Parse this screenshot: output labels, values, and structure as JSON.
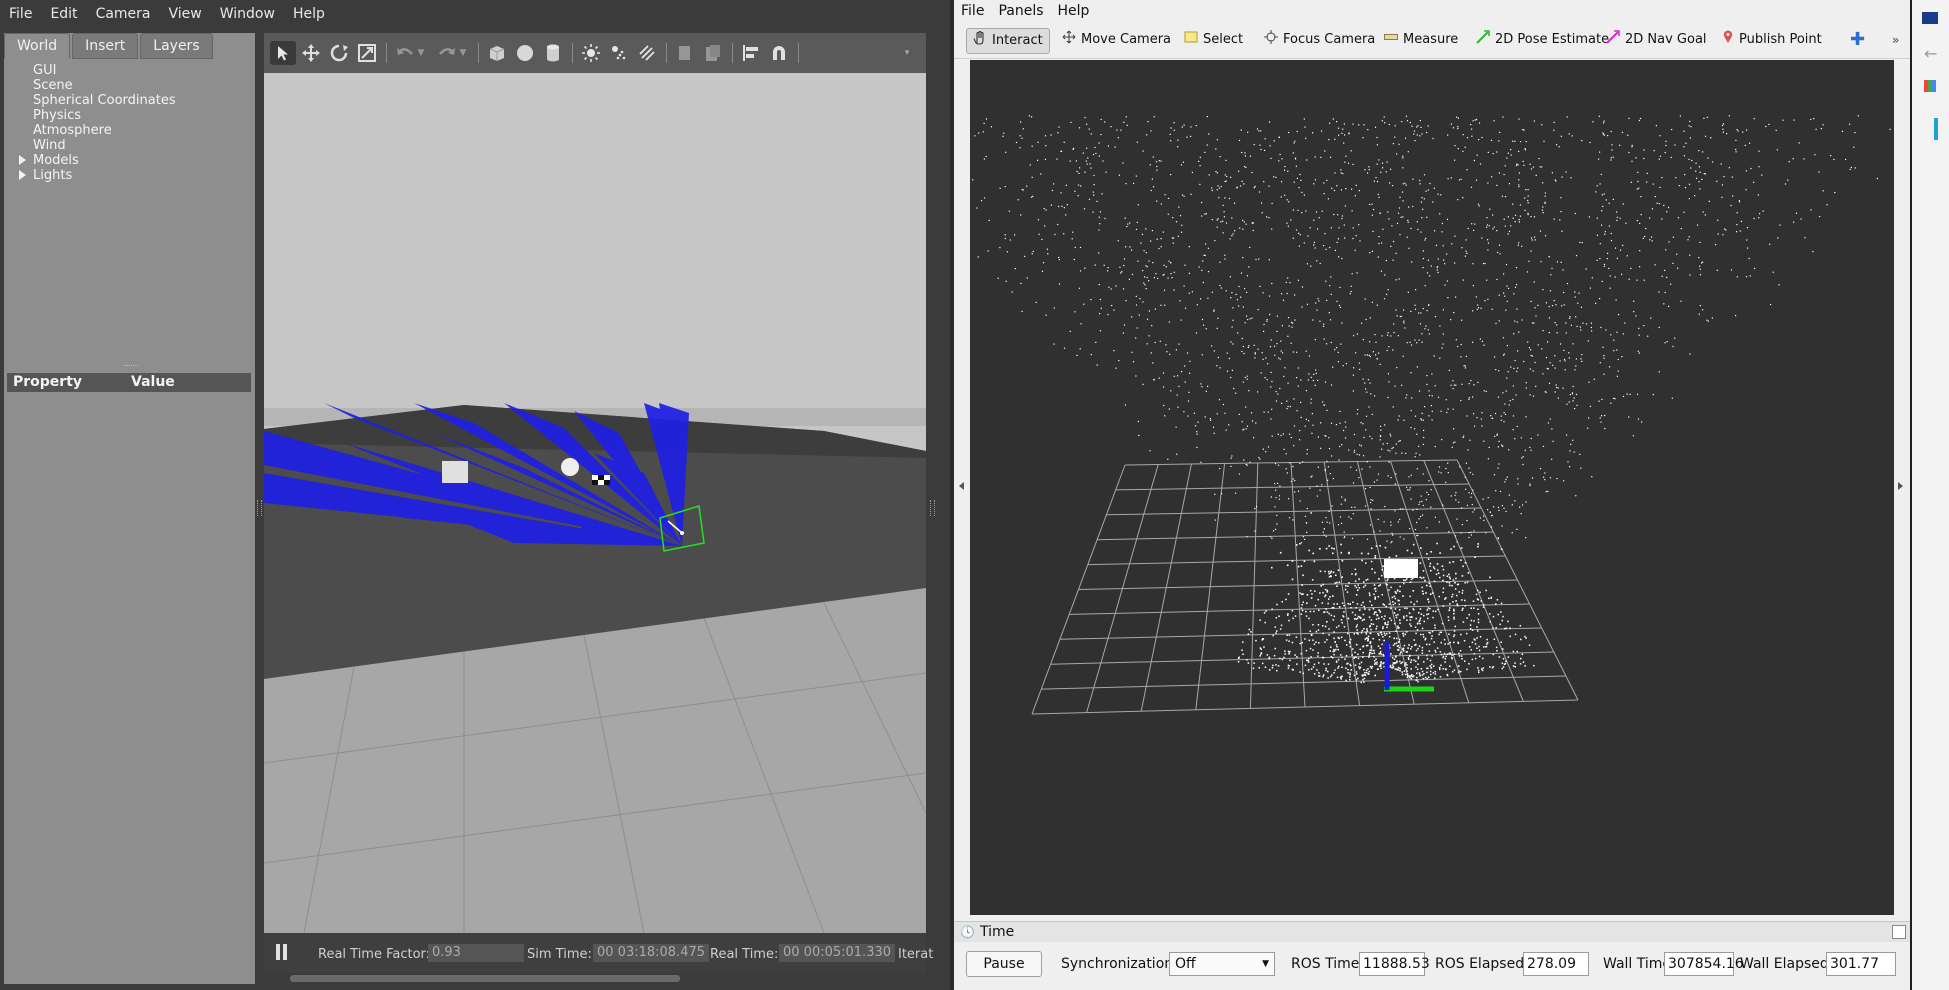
{
  "gazebo": {
    "menu": [
      "File",
      "Edit",
      "Camera",
      "View",
      "Window",
      "Help"
    ],
    "tabs": [
      "World",
      "Insert",
      "Layers"
    ],
    "tree": [
      {
        "label": "GUI",
        "expandable": false
      },
      {
        "label": "Scene",
        "expandable": false
      },
      {
        "label": "Spherical Coordinates",
        "expandable": false
      },
      {
        "label": "Physics",
        "expandable": false
      },
      {
        "label": "Atmosphere",
        "expandable": false
      },
      {
        "label": "Wind",
        "expandable": false
      },
      {
        "label": "Models",
        "expandable": true
      },
      {
        "label": "Lights",
        "expandable": true
      }
    ],
    "property_header": {
      "property": "Property",
      "value": "Value"
    },
    "status": {
      "real_time_factor_label": "Real Time Factor:",
      "real_time_factor": "0.93",
      "sim_time_label": "Sim Time:",
      "sim_time": "00 03:18:08.475",
      "real_time_label": "Real Time:",
      "real_time": "00 00:05:01.330",
      "iterations_label": "Iterat"
    }
  },
  "rviz": {
    "menu": [
      "File",
      "Panels",
      "Help"
    ],
    "tools": [
      {
        "label": "Interact",
        "icon": "hand-icon",
        "active": true
      },
      {
        "label": "Move Camera",
        "icon": "move-camera-icon",
        "active": false
      },
      {
        "label": "Select",
        "icon": "select-box-icon",
        "active": false
      },
      {
        "label": "Focus Camera",
        "icon": "focus-camera-icon",
        "active": false
      },
      {
        "label": "Measure",
        "icon": "ruler-icon",
        "active": false
      },
      {
        "label": "2D Pose Estimate",
        "icon": "green-arrow-icon",
        "active": false
      },
      {
        "label": "2D Nav Goal",
        "icon": "magenta-arrow-icon",
        "active": false
      },
      {
        "label": "Publish Point",
        "icon": "map-pin-icon",
        "active": false
      }
    ],
    "time_panel": {
      "title": "Time",
      "pause_label": "Pause",
      "sync_label": "Synchronization:",
      "sync_value": "Off",
      "ros_time_label": "ROS Time:",
      "ros_time": "11888.53",
      "ros_elapsed_label": "ROS Elapsed:",
      "ros_elapsed": "278.09",
      "wall_time_label": "Wall Time:",
      "wall_time": "307854.16",
      "wall_elapsed_label": "Wall Elapsed:",
      "wall_elapsed": "301.77"
    }
  },
  "colors": {
    "gazebo_panel": "#8e8e8e",
    "gazebo_bg": "#3b3b3b",
    "rviz_view_bg": "#303030",
    "laser_blue": "#1f1fe6",
    "axis_green": "#19d419",
    "axis_blue": "#1a1ad8"
  }
}
